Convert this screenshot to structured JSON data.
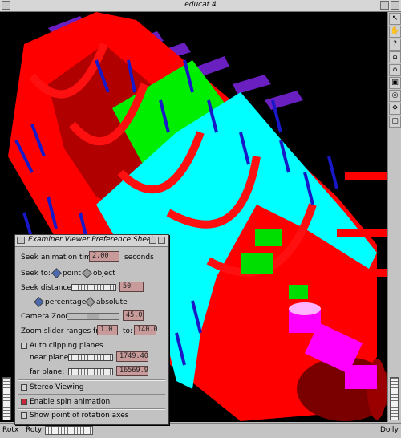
{
  "window": {
    "title": "educat 4"
  },
  "viewer": {
    "bottom": {
      "rotx_label": "Rotx",
      "roty_label": "Roty",
      "dolly_label": "Dolly"
    },
    "tools": [
      "pick-arrow-icon",
      "view-icon",
      "help-icon",
      "home-icon",
      "set-home-icon",
      "view-all-icon",
      "seek-icon",
      "perspective-icon",
      "projection-icon"
    ]
  },
  "dialog": {
    "title": "Examiner Viewer Preference Sheet",
    "seek_time_label": "Seek animation time:",
    "seek_time_value": "2.00",
    "seek_time_units": "seconds",
    "seek_to_label": "Seek to:",
    "seek_to_point": "point",
    "seek_to_object": "object",
    "seek_distance_label": "Seek distance:",
    "seek_distance_value": "50",
    "pct_label": "percentage",
    "abs_label": "absolute",
    "camera_zoom_label": "Camera Zoom:",
    "camera_zoom_value": "45.0",
    "zoom_range_label": "Zoom slider ranges from:",
    "zoom_from": "1.0",
    "zoom_to_label": "to:",
    "zoom_to": "140.0",
    "auto_clip_label": "Auto clipping planes",
    "near_label": "near plane:",
    "near_value": "1749.40",
    "far_label": "far plane:",
    "far_value": "16569.9",
    "stereo_label": "Stereo Viewing",
    "spin_label": "Enable spin animation",
    "rot_axes_label": "Show point of rotation axes"
  },
  "colors": {
    "red": "#ff0000",
    "cyan": "#00ffff",
    "green": "#00ff00",
    "blue": "#1818c8",
    "purple": "#7a2ad0",
    "magenta": "#ff00ff",
    "dialog_bg": "#c2c2c2",
    "field_bg": "#c99a9a"
  }
}
